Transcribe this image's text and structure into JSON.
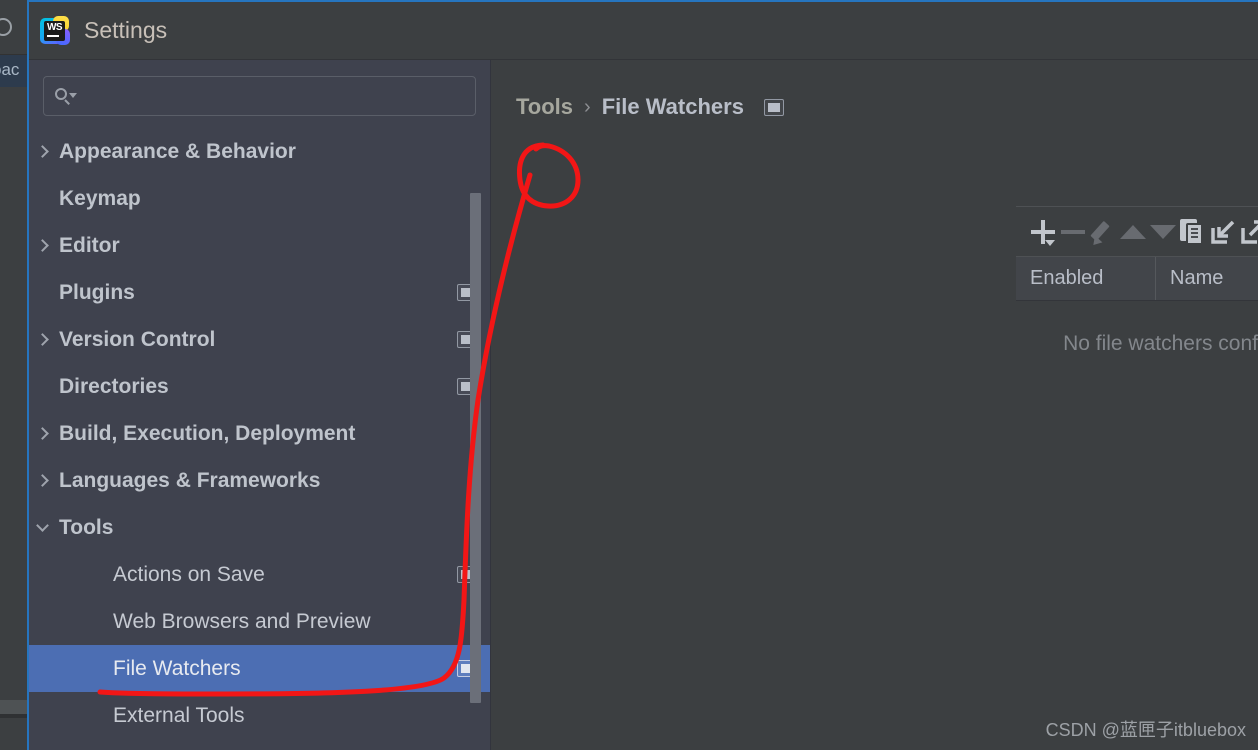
{
  "background_window": {
    "tab_label_fragment": "pac",
    "circle_icon": "circle-icon"
  },
  "dialog": {
    "title": "Settings",
    "logo_text": "WS",
    "accent_border_color": "#2675BF"
  },
  "search": {
    "value": "",
    "placeholder": "",
    "icon": "search-icon"
  },
  "sidebar": {
    "items": [
      {
        "label": "Appearance & Behavior",
        "indent": 0,
        "expander": "right",
        "bold": true,
        "scope_icon": false,
        "selected": false
      },
      {
        "label": "Keymap",
        "indent": 0,
        "expander": "none",
        "bold": true,
        "scope_icon": false,
        "selected": false
      },
      {
        "label": "Editor",
        "indent": 0,
        "expander": "right",
        "bold": true,
        "scope_icon": false,
        "selected": false
      },
      {
        "label": "Plugins",
        "indent": 0,
        "expander": "none",
        "bold": true,
        "scope_icon": true,
        "selected": false
      },
      {
        "label": "Version Control",
        "indent": 0,
        "expander": "right",
        "bold": true,
        "scope_icon": true,
        "selected": false
      },
      {
        "label": "Directories",
        "indent": 0,
        "expander": "none",
        "bold": true,
        "scope_icon": true,
        "selected": false
      },
      {
        "label": "Build, Execution, Deployment",
        "indent": 0,
        "expander": "right",
        "bold": true,
        "scope_icon": false,
        "selected": false
      },
      {
        "label": "Languages & Frameworks",
        "indent": 0,
        "expander": "right",
        "bold": true,
        "scope_icon": false,
        "selected": false
      },
      {
        "label": "Tools",
        "indent": 0,
        "expander": "down",
        "bold": true,
        "scope_icon": false,
        "selected": false
      },
      {
        "label": "Actions on Save",
        "indent": 1,
        "expander": "none",
        "bold": false,
        "scope_icon": true,
        "selected": false
      },
      {
        "label": "Web Browsers and Preview",
        "indent": 1,
        "expander": "none",
        "bold": false,
        "scope_icon": false,
        "selected": false
      },
      {
        "label": "File Watchers",
        "indent": 1,
        "expander": "none",
        "bold": false,
        "scope_icon": true,
        "selected": true
      },
      {
        "label": "External Tools",
        "indent": 1,
        "expander": "none",
        "bold": false,
        "scope_icon": false,
        "selected": false
      }
    ],
    "selection_color": "#4C6EB3"
  },
  "breadcrumb": {
    "parent": "Tools",
    "separator": "›",
    "current": "File Watchers",
    "scope_icon": "project-scope-icon"
  },
  "toolbar": {
    "buttons": [
      {
        "name": "add-button",
        "icon": "plus-icon",
        "label": "Add",
        "enabled": true,
        "has_dropdown": true
      },
      {
        "name": "remove-button",
        "icon": "minus-icon",
        "label": "Remove",
        "enabled": false,
        "has_dropdown": false
      },
      {
        "name": "edit-button",
        "icon": "pencil-icon",
        "label": "Edit",
        "enabled": false,
        "has_dropdown": false
      },
      {
        "name": "move-up-button",
        "icon": "arrow-up-icon",
        "label": "Move Up",
        "enabled": false,
        "has_dropdown": false
      },
      {
        "name": "move-down-button",
        "icon": "arrow-down-icon",
        "label": "Move Down",
        "enabled": false,
        "has_dropdown": false
      },
      {
        "name": "copy-button",
        "icon": "copy-icon",
        "label": "Copy",
        "enabled": true,
        "has_dropdown": false
      },
      {
        "name": "import-button",
        "icon": "import-icon",
        "label": "Import",
        "enabled": true,
        "has_dropdown": false
      },
      {
        "name": "export-button",
        "icon": "export-icon",
        "label": "Export",
        "enabled": true,
        "has_dropdown": false
      }
    ]
  },
  "table": {
    "columns": [
      "Enabled",
      "Name"
    ],
    "rows": [],
    "empty_message": "No file watchers conf"
  },
  "watermark": {
    "text": "CSDN @蓝匣子itbluebox"
  },
  "annotation": {
    "color": "#F21616",
    "shapes": [
      "circle-around-add-button",
      "curve-to-file-watchers-item"
    ]
  }
}
